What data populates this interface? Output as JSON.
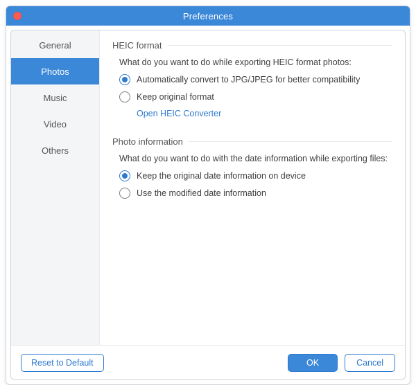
{
  "window": {
    "title": "Preferences"
  },
  "sidebar": {
    "tabs": [
      {
        "label": "General"
      },
      {
        "label": "Photos"
      },
      {
        "label": "Music"
      },
      {
        "label": "Video"
      },
      {
        "label": "Others"
      }
    ],
    "selectedIndex": 1
  },
  "content": {
    "heic": {
      "title": "HEIC format",
      "question": "What do you want to do while exporting HEIC format photos:",
      "option1": "Automatically convert to JPG/JPEG for better compatibility",
      "option2": "Keep original format",
      "link": "Open HEIC Converter",
      "selected": 1
    },
    "photoInfo": {
      "title": "Photo information",
      "question": "What do you want to do with the date information while exporting files:",
      "option1": "Keep the original date information on device",
      "option2": "Use the modified date information",
      "selected": 1
    }
  },
  "footer": {
    "reset": "Reset to Default",
    "ok": "OK",
    "cancel": "Cancel"
  }
}
